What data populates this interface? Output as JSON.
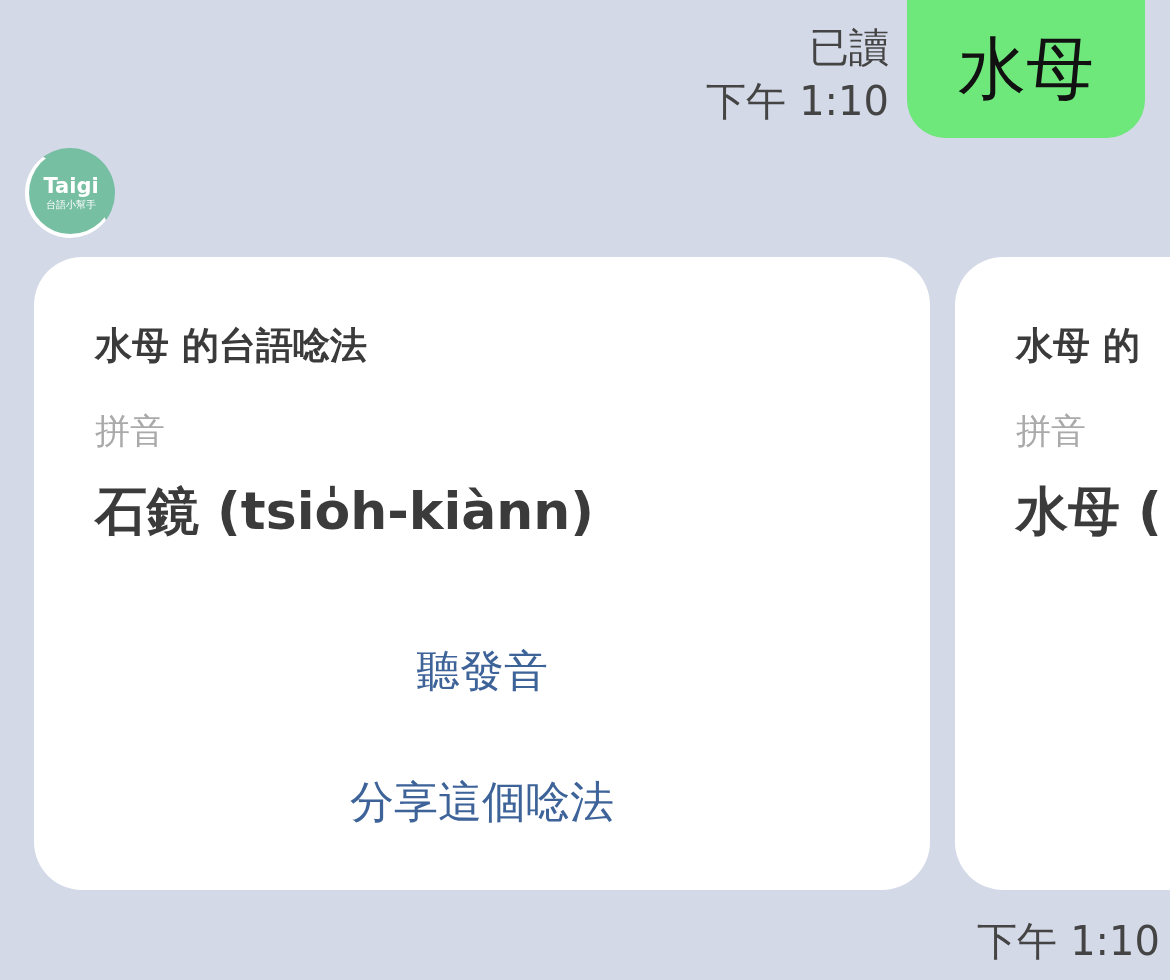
{
  "sent_message": {
    "read_status": "已讀",
    "time": "下午 1:10",
    "text": "水母"
  },
  "bot_avatar": {
    "title": "Taigi",
    "subtitle": "台語小幫手"
  },
  "cards": [
    {
      "title": "水母 的台語唸法",
      "label": "拼音",
      "reading": "石鏡 (tsio̍h-kiànn)",
      "actions": [
        "聽發音",
        "分享這個唸法"
      ]
    },
    {
      "title": "水母 的",
      "label": "拼音",
      "reading": "水母 ("
    }
  ],
  "card_time": "下午 1:10"
}
